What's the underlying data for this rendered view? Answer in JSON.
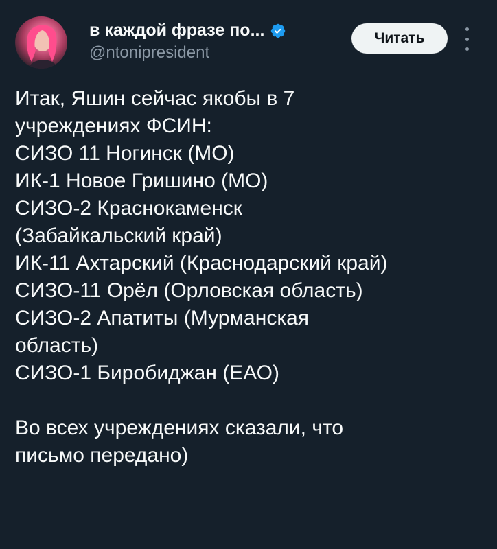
{
  "author": {
    "display_name": "в каждой фразе по...",
    "handle": "@ntonipresident",
    "verified": true,
    "avatar_icon": "avatar-photo"
  },
  "actions": {
    "follow_label": "Читать",
    "more_icon": "more-vertical-icon"
  },
  "tweet": {
    "lines": [
      "Итак, Яшин сейчас якобы в 7",
      "учреждениях ФСИН:",
      "СИЗО 11 Ногинск (МО)",
      "ИК-1 Новое Гришино (МО)",
      "СИЗО-2 Краснокаменск",
      "(Забайкальский край)",
      "ИК-11 Ахтарский (Краснодарский край)",
      "СИЗО-11 Орёл (Орловская область)",
      "СИЗО-2 Апатиты (Мурманская",
      "область)",
      "СИЗО-1 Биробиджан (ЕАО)",
      "",
      "Во всех учреждениях сказали, что",
      "письмо передано)"
    ]
  },
  "colors": {
    "background": "#15202b",
    "text_primary": "#f7f9f9",
    "text_secondary": "#8b98a5",
    "verified_blue": "#1d9bf0",
    "button_bg": "#eff3f4",
    "button_text": "#0f1419"
  }
}
